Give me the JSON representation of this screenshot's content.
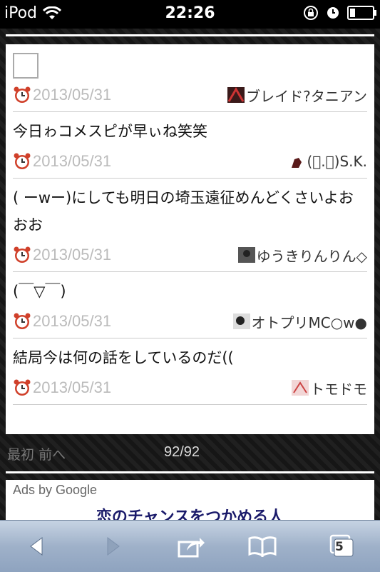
{
  "status_bar": {
    "carrier": "iPod",
    "time": "22:26"
  },
  "top_fragment": "ー   ー ー ー",
  "comments": [
    {
      "text": "",
      "date": "2013/05/31",
      "author": "ブレイド?タニアン",
      "has_placeholder": true
    },
    {
      "text": "今日ゎコメスピが早ぃね笑笑",
      "date": "2013/05/31",
      "author": "(ﾟ.ﾟ)S.K."
    },
    {
      "text": "( ーwー)にしても明日の埼玉遠征めんどくさいよおおお",
      "date": "2013/05/31",
      "author": "ゆうきりんりん◇"
    },
    {
      "text": "(￣▽￣)",
      "date": "2013/05/31",
      "author": "オトプリMC○w●"
    },
    {
      "text": "結局今は何の話をしているのだ((",
      "date": "2013/05/31",
      "author": "トモドモ"
    }
  ],
  "pager": {
    "first": "最初",
    "prev": "前へ",
    "count": "92/92"
  },
  "ad": {
    "label": "Ads by Google",
    "headline": "恋のチャンスをつかめる人"
  },
  "toolbar": {
    "tabs_count": "5"
  }
}
